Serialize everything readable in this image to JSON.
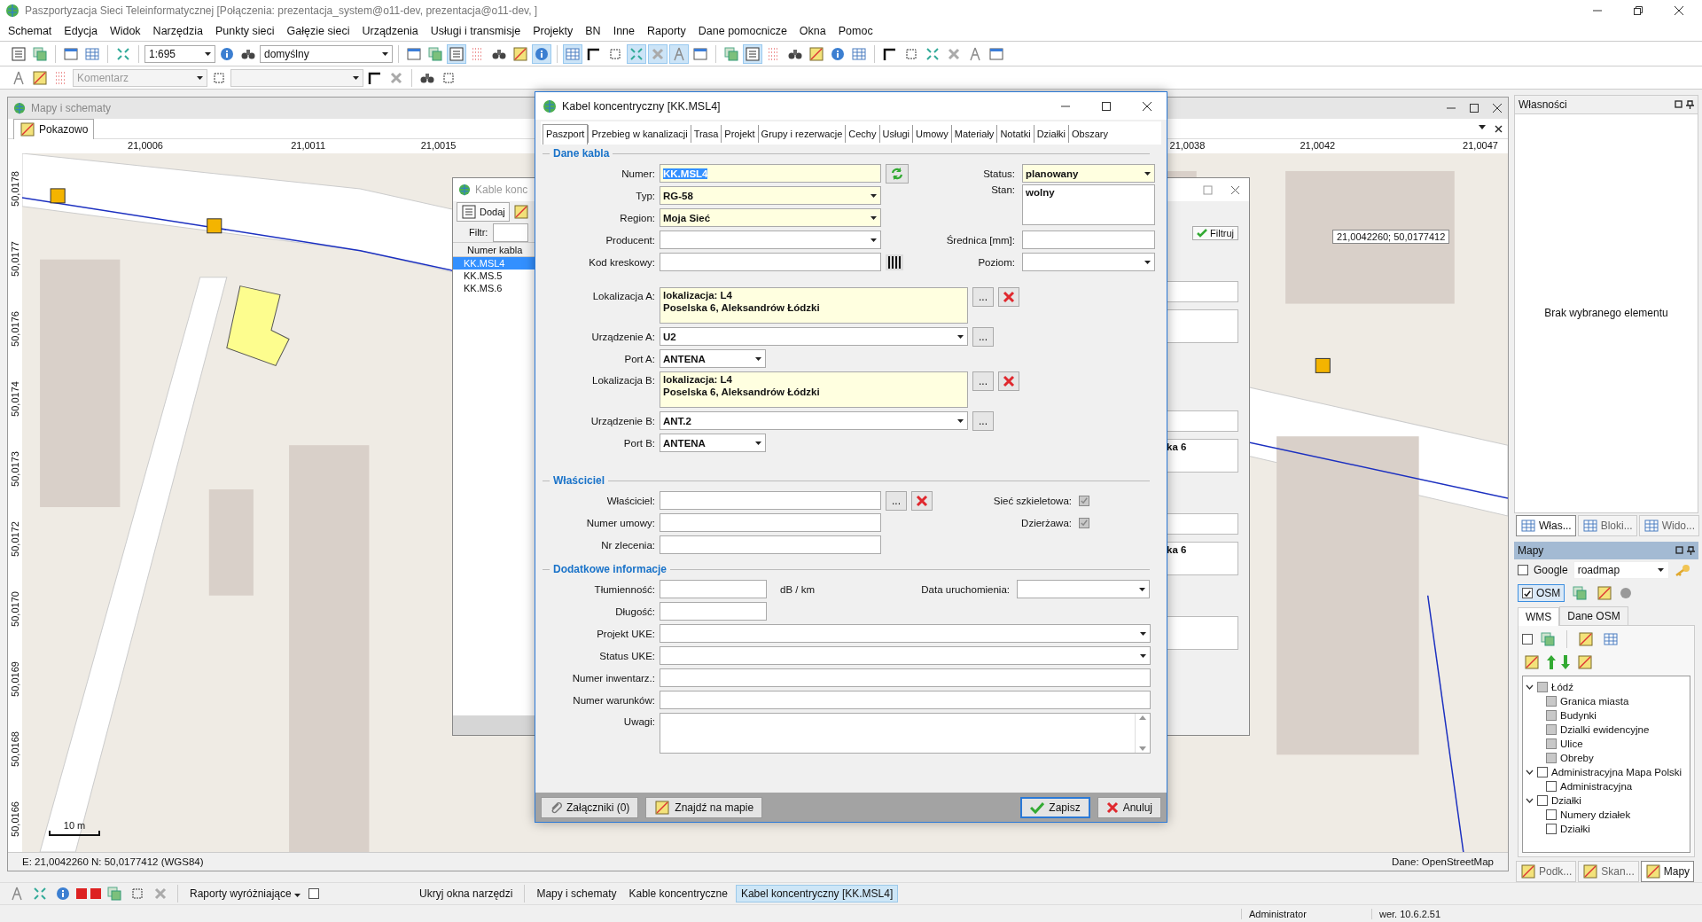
{
  "window": {
    "title": "Paszportyzacja Sieci Teleinformatycznej [Połączenia: prezentacja_system@o11-dev, prezentacja@o11-dev, ]"
  },
  "menu": [
    "Schemat",
    "Edycja",
    "Widok",
    "Narzędzia",
    "Punkty sieci",
    "Gałęzie sieci",
    "Urządzenia",
    "Usługi i transmisje",
    "Projekty",
    "BN",
    "Inne",
    "Raporty",
    "Dane pomocnicze",
    "Okna",
    "Pomoc"
  ],
  "main_toolbar": {
    "scale": "1:695",
    "style": "domyślny",
    "tools": [
      {
        "pressed": false
      },
      {
        "pressed": false
      },
      {
        "pressed": true
      },
      {
        "pressed": false
      },
      {
        "pressed": false
      },
      {
        "pressed": false
      },
      {
        "pressed": true
      },
      {
        "pressed": true
      },
      {
        "pressed": false
      },
      {
        "pressed": false
      },
      {
        "pressed": true
      },
      {
        "pressed": true
      },
      {
        "pressed": true
      },
      {
        "pressed": false
      },
      {
        "pressed": false
      },
      {
        "pressed": true
      },
      {
        "pressed": false
      },
      {
        "pressed": false
      },
      {
        "pressed": false
      },
      {
        "pressed": false
      },
      {
        "pressed": false
      },
      {
        "pressed": false
      },
      {
        "pressed": false
      },
      {
        "pressed": false
      },
      {
        "pressed": false
      },
      {
        "pressed": false
      },
      {
        "pressed": false
      }
    ]
  },
  "edit_toolbar": {
    "comment": "Komentarz"
  },
  "map_window": {
    "title": "Mapy i schematy",
    "tab": "Pokazowo",
    "x_ticks": [
      "21,0006",
      "21,0011",
      "21,0015",
      "21,0038",
      "21,0042",
      "21,0047"
    ],
    "y_ticks": [
      "50,0178",
      "50,0177",
      "50,0176",
      "50,0174",
      "50,0173",
      "50,0172",
      "50,0170",
      "50,0169",
      "50,0168",
      "50,0166"
    ],
    "tooltip": "21,0042260; 50,0177412",
    "scale_label": "10 m",
    "coords": "E: 21,0042260   N: 50,0177412 (WGS84)",
    "source": "Dane: OpenStreetMap"
  },
  "cables_window": {
    "title": "Kable konc",
    "add_button": "Dodaj",
    "filter_label": "Filtr:",
    "column": "Numer kabla",
    "rows": [
      {
        "text": "KK.MSL4",
        "selected": true
      },
      {
        "text": "KK.MS.5",
        "selected": false
      },
      {
        "text": "KK.MS.6",
        "selected": false
      }
    ]
  },
  "back_window": {
    "filter_button": "Filtruj",
    "values": [
      "ka 6",
      "ka 6"
    ]
  },
  "dialog": {
    "title": "Kabel koncentryczny [KK.MSL4]",
    "browse": "...",
    "tabs": [
      {
        "label": "Paszport",
        "selected": true
      },
      {
        "label": "Przebieg w kanalizacji",
        "selected": false
      },
      {
        "label": "Trasa",
        "selected": false
      },
      {
        "label": "Projekt",
        "selected": false
      },
      {
        "label": "Grupy i rezerwacje",
        "selected": false
      },
      {
        "label": "Cechy",
        "selected": false
      },
      {
        "label": "Usługi",
        "selected": false
      },
      {
        "label": "Umowy",
        "selected": false
      },
      {
        "label": "Materiały",
        "selected": false
      },
      {
        "label": "Notatki",
        "selected": false
      },
      {
        "label": "Działki",
        "selected": false
      },
      {
        "label": "Obszary",
        "selected": false
      }
    ],
    "cable": {
      "legend": "Dane kabla",
      "numer": {
        "label": "Numer:",
        "value": "KK.MSL4",
        "required": true,
        "text_selected": true
      },
      "typ": {
        "label": "Typ:",
        "value": "RG-58",
        "required": true
      },
      "region": {
        "label": "Region:",
        "value": "Moja Sieć",
        "required": true
      },
      "producent": {
        "label": "Producent:",
        "required": false
      },
      "kod": {
        "label": "Kod kreskowy:",
        "required": false
      },
      "status": {
        "label": "Status:",
        "value": "planowany",
        "required": true
      },
      "stan": {
        "label": "Stan:",
        "value": "wolny",
        "required": false
      },
      "srednica": {
        "label": "Średnica [mm]:",
        "required": false
      },
      "poziom": {
        "label": "Poziom:",
        "required": false
      },
      "lokalizacja_a": {
        "label": "Lokalizacja A:",
        "lines": [
          "lokalizacja: L4",
          "Poselska 6, Aleksandrów Łódzki"
        ],
        "required": true
      },
      "urzadzenie_a": {
        "label": "Urządzenie A:",
        "value": "U2",
        "required": false
      },
      "port_a": {
        "label": "Port A:",
        "value": "ANTENA",
        "required": false
      },
      "lokalizacja_b": {
        "label": "Lokalizacja B:",
        "lines": [
          "lokalizacja: L4",
          "Poselska 6, Aleksandrów Łódzki"
        ],
        "required": true
      },
      "urzadzenie_b": {
        "label": "Urządzenie B:",
        "value": "ANT.2",
        "required": false
      },
      "port_b": {
        "label": "Port B:",
        "value": "ANTENA",
        "required": false
      }
    },
    "owner": {
      "legend": "Właściciel",
      "wlasciciel": {
        "label": "Właściciel:"
      },
      "numer_umowy": {
        "label": "Numer umowy:"
      },
      "nr_zlecenia": {
        "label": "Nr zlecenia:"
      },
      "siec": {
        "label": "Sieć szkieletowa:",
        "checked": true
      },
      "dzierzawa": {
        "label": "Dzierżawa:",
        "checked": true
      }
    },
    "extra": {
      "legend": "Dodatkowe informacje",
      "tlumiennosc": {
        "label": "Tłumienność:",
        "unit": "dB / km"
      },
      "data_uruchomienia": {
        "label": "Data uruchomienia:"
      },
      "dlugosc": {
        "label": "Długość:"
      },
      "projekt_uke": {
        "label": "Projekt UKE:"
      },
      "status_uke": {
        "label": "Status UKE:"
      },
      "numer_inwentarz": {
        "label": "Numer inwentarz.:"
      },
      "numer_warunkow": {
        "label": "Numer warunków:"
      },
      "uwagi": {
        "label": "Uwagi:"
      }
    },
    "buttons": {
      "attachments": "Załączniki (0)",
      "find": "Znajdź na mapie",
      "save": "Zapisz",
      "cancel": "Anuluj"
    }
  },
  "properties": {
    "title": "Własności",
    "empty": "Brak wybranego elementu",
    "tabs": [
      {
        "label": "Włas...",
        "selected": true
      },
      {
        "label": "Bloki...",
        "selected": false
      },
      {
        "label": "Wido...",
        "selected": false
      }
    ]
  },
  "maps": {
    "title": "Mapy",
    "google": {
      "label": "Google",
      "checked": false,
      "mode": "roadmap"
    },
    "osm": {
      "label": "OSM",
      "checked": true
    },
    "tabs": [
      {
        "label": "WMS",
        "selected": true
      },
      {
        "label": "Dane OSM",
        "selected": false
      }
    ],
    "select_all": {
      "checked": false
    },
    "tree": [
      {
        "label": "Łódź",
        "greyed": true,
        "expanded": true,
        "children": [
          {
            "label": "Granica miasta",
            "greyed": true
          },
          {
            "label": "Budynki",
            "greyed": true
          },
          {
            "label": "Dzialki ewidencyjne",
            "greyed": true
          },
          {
            "label": "Ulice",
            "greyed": true
          },
          {
            "label": "Obreby",
            "greyed": true
          }
        ]
      },
      {
        "label": "Administracyjna Mapa Polski",
        "greyed": false,
        "expanded": true,
        "children": [
          {
            "label": "Administracyjna",
            "greyed": false
          }
        ]
      },
      {
        "label": "Działki",
        "greyed": false,
        "expanded": true,
        "children": [
          {
            "label": "Numery działek",
            "greyed": false
          },
          {
            "label": "Działki",
            "greyed": false
          }
        ]
      }
    ],
    "bottom_tabs": [
      {
        "label": "Podk...",
        "selected": false
      },
      {
        "label": "Skan...",
        "selected": false
      },
      {
        "label": "Mapy",
        "selected": true
      }
    ]
  },
  "taskbar": {
    "reports": "Raporty wyróżniające",
    "option": {
      "checked": false
    },
    "hide_tools": "Ukryj okna narzędzi",
    "windows": [
      {
        "label": "Mapy i schematy",
        "selected": false
      },
      {
        "label": "Kable koncentryczne",
        "selected": false
      },
      {
        "label": "Kabel koncentryczny [KK.MSL4]",
        "selected": true
      }
    ]
  },
  "status_bar": {
    "user": "Administrator",
    "version": "wer. 10.6.2.51"
  }
}
